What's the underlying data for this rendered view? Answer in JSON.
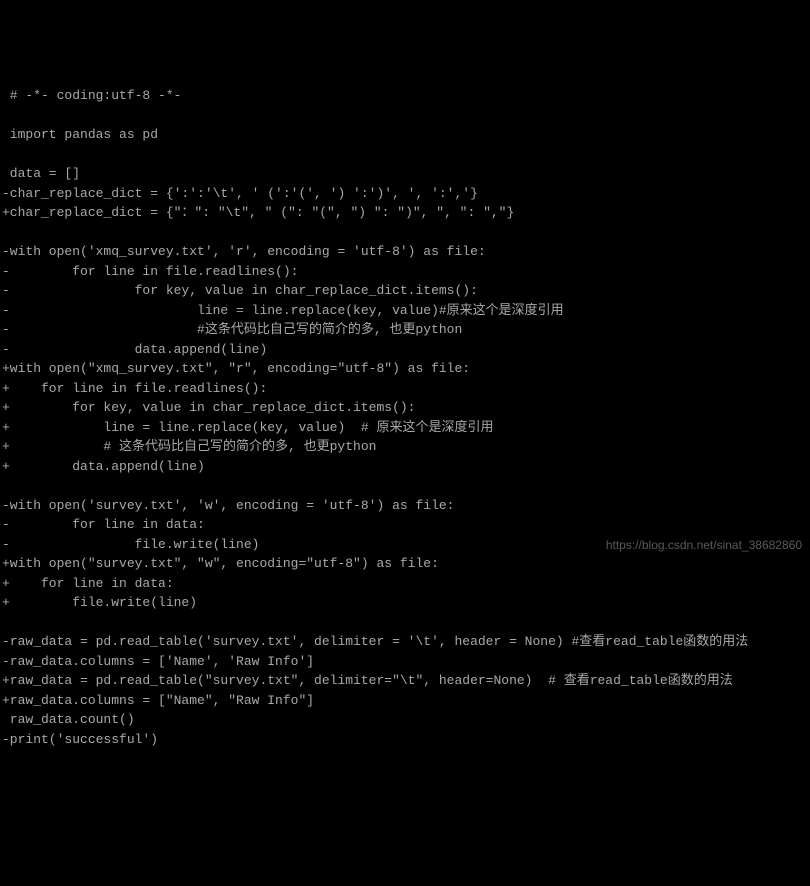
{
  "code": {
    "lines": [
      " # -*- coding:utf-8 -*-",
      "",
      " import pandas as pd",
      "",
      " data = []",
      "-char_replace_dict = {':':'\\t', ' (':'(', ') ':')', ', ':','}",
      "+char_replace_dict = {\"：\": \"\\t\", \" (\": \"(\", \") \": \")\", \", \": \",\"}",
      "",
      "-with open('xmq_survey.txt', 'r', encoding = 'utf-8') as file:",
      "-        for line in file.readlines():",
      "-                for key, value in char_replace_dict.items():",
      "-                        line = line.replace(key, value)#原来这个是深度引用",
      "-                        #这条代码比自己写的简介的多, 也更python",
      "-                data.append(line)",
      "+with open(\"xmq_survey.txt\", \"r\", encoding=\"utf-8\") as file:",
      "+    for line in file.readlines():",
      "+        for key, value in char_replace_dict.items():",
      "+            line = line.replace(key, value)  # 原来这个是深度引用",
      "+            # 这条代码比自己写的简介的多, 也更python",
      "+        data.append(line)",
      "",
      "-with open('survey.txt', 'w', encoding = 'utf-8') as file:",
      "-        for line in data:",
      "-                file.write(line)",
      "+with open(\"survey.txt\", \"w\", encoding=\"utf-8\") as file:",
      "+    for line in data:",
      "+        file.write(line)",
      "",
      "-raw_data = pd.read_table('survey.txt', delimiter = '\\t', header = None) #查看read_table函数的用法",
      "-raw_data.columns = ['Name', 'Raw Info']",
      "+raw_data = pd.read_table(\"survey.txt\", delimiter=\"\\t\", header=None)  # 查看read_table函数的用法",
      "+raw_data.columns = [\"Name\", \"Raw Info\"]",
      " raw_data.count()",
      "-print('successful')"
    ]
  },
  "watermark": "https://blog.csdn.net/sinat_38682860"
}
